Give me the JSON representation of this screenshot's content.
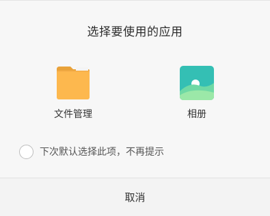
{
  "dialog": {
    "title": "选择要使用的应用",
    "apps": [
      {
        "label": "文件管理",
        "icon": "folder-icon",
        "color": "#FDB84E"
      },
      {
        "label": "相册",
        "icon": "gallery-icon",
        "color": "#3CC0B5"
      }
    ],
    "remember_label": "下次默认选择此项，不再提示",
    "remember_checked": false,
    "cancel_label": "取消"
  }
}
